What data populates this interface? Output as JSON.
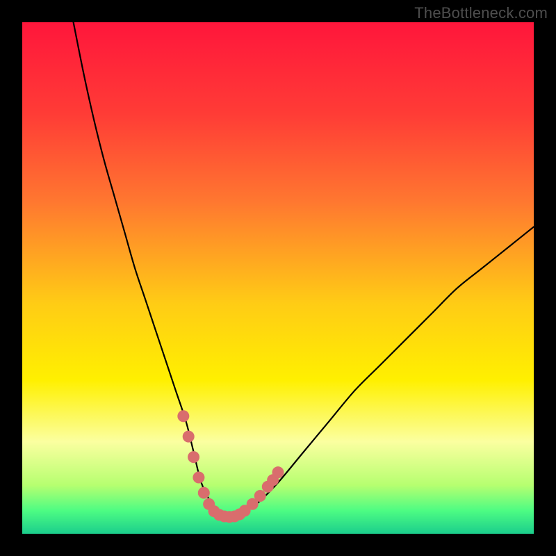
{
  "watermark": "TheBottleneck.com",
  "chart_data": {
    "type": "line",
    "title": "",
    "xlabel": "",
    "ylabel": "",
    "xlim": [
      0,
      100
    ],
    "ylim": [
      0,
      100
    ],
    "gradient_stops": [
      {
        "offset": 0.0,
        "color": "#ff163b"
      },
      {
        "offset": 0.18,
        "color": "#ff3c36"
      },
      {
        "offset": 0.35,
        "color": "#ff7730"
      },
      {
        "offset": 0.55,
        "color": "#ffcc15"
      },
      {
        "offset": 0.7,
        "color": "#fff000"
      },
      {
        "offset": 0.82,
        "color": "#fbffa0"
      },
      {
        "offset": 0.905,
        "color": "#b6ff70"
      },
      {
        "offset": 0.955,
        "color": "#4dfc83"
      },
      {
        "offset": 1.0,
        "color": "#1bce8c"
      }
    ],
    "series": [
      {
        "name": "bottleneck-curve",
        "color": "#000000",
        "x": [
          10,
          12,
          14,
          16,
          18,
          20,
          22,
          24,
          26,
          28,
          30,
          32,
          33.5,
          35,
          37,
          39,
          41,
          43,
          46,
          50,
          55,
          60,
          65,
          70,
          75,
          80,
          85,
          90,
          95,
          100
        ],
        "y": [
          100,
          90,
          81,
          73,
          66,
          59,
          52,
          46,
          40,
          34,
          28,
          22,
          16,
          10,
          6,
          4,
          3.5,
          4,
          6,
          10,
          16,
          22,
          28,
          33,
          38,
          43,
          48,
          52,
          56,
          60
        ]
      },
      {
        "name": "valley-marker",
        "color": "#d96d6d",
        "type": "scatter",
        "x": [
          31.5,
          32.5,
          33.5,
          34.5,
          35.5,
          36.5,
          37.5,
          38.5,
          39.5,
          40.5,
          41.5,
          42.5,
          43.5,
          45.0,
          46.5,
          48.0,
          49.0,
          50.0
        ],
        "y": [
          23,
          19,
          15,
          11,
          8,
          5.8,
          4.4,
          3.7,
          3.4,
          3.3,
          3.4,
          3.8,
          4.5,
          5.8,
          7.4,
          9.2,
          10.5,
          12
        ]
      }
    ]
  }
}
